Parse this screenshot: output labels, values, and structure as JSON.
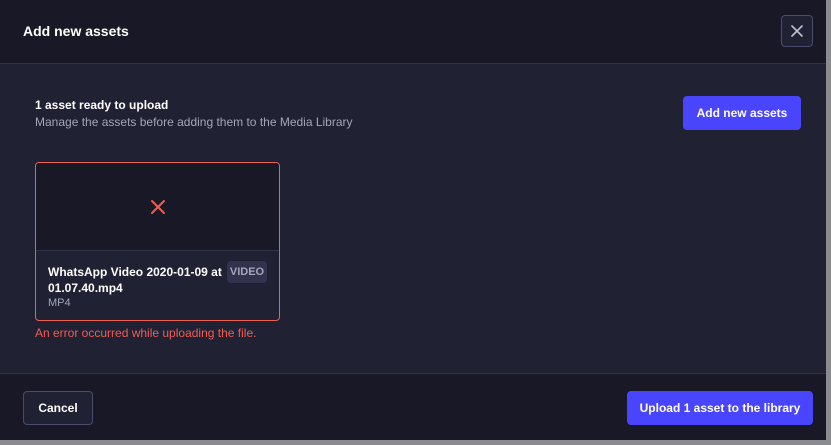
{
  "colors": {
    "accent": "#4945ff",
    "danger": "#ee5e52",
    "background": "#212134",
    "header_background": "#181826"
  },
  "header": {
    "title": "Add new assets",
    "close_icon": "close-icon"
  },
  "summary": {
    "title": "1 asset ready to upload",
    "subtitle": "Manage the assets before adding them to the Media Library",
    "add_button_label": "Add new assets"
  },
  "assets": [
    {
      "name": "WhatsApp Video 2020-01-09 at 01.07.40.mp4",
      "extension": "MP4",
      "type_badge": "VIDEO",
      "preview_icon": "error-x-icon",
      "error": "An error occurred while uploading the file."
    }
  ],
  "footer": {
    "cancel_label": "Cancel",
    "upload_label": "Upload 1 asset to the library"
  }
}
